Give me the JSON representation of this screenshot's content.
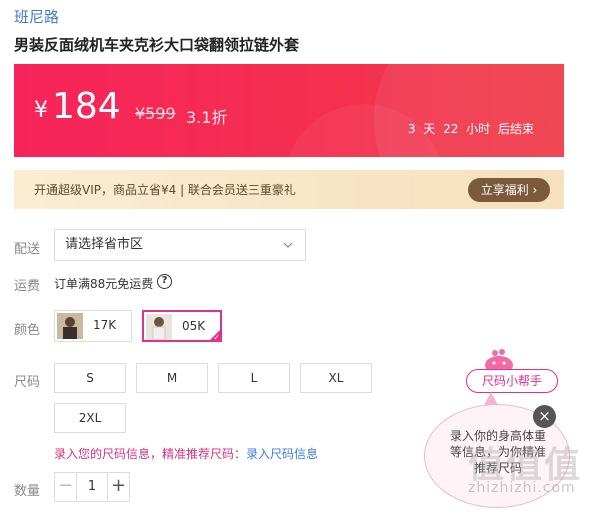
{
  "product": {
    "brand": "班尼路",
    "title": "男装反面绒机车夹克衫大口袋翻领拉链外套"
  },
  "price": {
    "currency": "¥",
    "current": "184",
    "original": "¥599",
    "discount": "3.1折",
    "countdown": "3 天 22 小时 后结束"
  },
  "colors": {
    "banner_start": "#f7245b",
    "banner_end": "#ee3b48",
    "accent_pink": "#e0318c",
    "link_blue": "#3d7bd6"
  },
  "vip": {
    "text": "开通超级VIP，商品立省¥4 | 联合会员送三重豪礼",
    "button": "立享福利 ›"
  },
  "delivery": {
    "label": "配送",
    "placeholder": "请选择省市区",
    "chevron": "chevron-down-icon"
  },
  "freight": {
    "label": "运费",
    "text": "订单满88元免运费",
    "help": "?"
  },
  "color_select": {
    "label": "颜色",
    "options": [
      {
        "name": "17K",
        "selected": false
      },
      {
        "name": "05K",
        "selected": true
      }
    ]
  },
  "size_select": {
    "label": "尺码",
    "options": [
      "S",
      "M",
      "L",
      "XL",
      "2XL"
    ]
  },
  "size_tip": {
    "pink": "录入您的尺码信息，精准推荐尺码：",
    "link": "录入尺码信息"
  },
  "quantity": {
    "label": "数量",
    "minus": "−",
    "value": "1",
    "plus": "+"
  },
  "size_helper": {
    "button": "尺码小帮手",
    "bubble_text": "录入你的身高体重等信息，为你精准推荐尺码",
    "close": "×"
  },
  "watermark": {
    "glyphs": "值值值",
    "url": "zhizhizhi.com"
  }
}
